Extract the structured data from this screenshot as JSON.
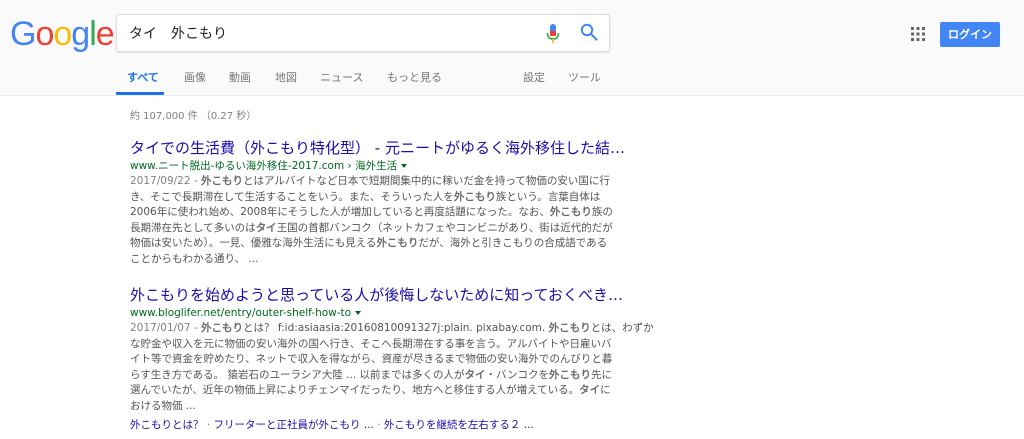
{
  "logo": {
    "letters": [
      {
        "ch": "G",
        "color": "#4285F4"
      },
      {
        "ch": "o",
        "color": "#EA4335"
      },
      {
        "ch": "o",
        "color": "#FBBC05"
      },
      {
        "ch": "g",
        "color": "#4285F4"
      },
      {
        "ch": "l",
        "color": "#34A853"
      },
      {
        "ch": "e",
        "color": "#EA4335"
      }
    ]
  },
  "search": {
    "query": "タイ　外こもり"
  },
  "header": {
    "login_label": "ログイン"
  },
  "icons": {
    "mic": "mic-icon",
    "search": "search-icon",
    "apps": "apps-grid-icon"
  },
  "tabs": [
    {
      "label": "すべて",
      "active": true
    },
    {
      "label": "画像"
    },
    {
      "label": "動画"
    },
    {
      "label": "地図"
    },
    {
      "label": "ニュース"
    },
    {
      "label": "もっと見る"
    },
    {
      "label": "設定"
    },
    {
      "label": "ツール"
    }
  ],
  "result_stats": "約 107,000 件 （0.27 秒）",
  "results": [
    {
      "title": "タイでの生活費（外こもり特化型） - 元ニートがゆるく海外移住した結…",
      "url": "www.ニート脱出-ゆるい海外移住-2017.com › 海外生活",
      "date": "2017/09/22 - ",
      "snippet_lines": [
        [
          {
            "b": "外こもり"
          },
          {
            "t": "とはアルバイトなど日本で短期間集中的に稼いだ金を持って物価の安い国に行"
          }
        ],
        [
          {
            "t": "き、そこで長期滞在して生活することをいう。また、そういった人を"
          },
          {
            "b": "外こもり"
          },
          {
            "t": "族という。言葉自体は"
          }
        ],
        [
          {
            "t": "2006年に使われ始め、2008年にそうした人が増加していると再度話題になった。なお、"
          },
          {
            "b": "外こもり"
          },
          {
            "t": "族の"
          }
        ],
        [
          {
            "t": "長期滞在先として多いのは"
          },
          {
            "b": "タイ"
          },
          {
            "t": "王国の首都バンコク（ネットカフェやコンビニがあり、街は近代的だが"
          }
        ],
        [
          {
            "t": "物価は安いため）。一見、優雅な海外生活にも見える"
          },
          {
            "b": "外こもり"
          },
          {
            "t": "だが、海外と引きこもりの合成語である"
          }
        ],
        [
          {
            "t": "ことからもわかる通り、 ..."
          }
        ]
      ]
    },
    {
      "title": "外こもりを始めようと思っている人が後悔しないために知っておくべき…",
      "url": "www.bloglifer.net/entry/outer-shelf-how-to",
      "date": "2017/01/07 - ",
      "snippet_lines": [
        [
          {
            "b": "外こもり"
          },
          {
            "t": "とは？ f:id:asiaasia:20160810091327j:plain. pixabay.com. "
          },
          {
            "b": "外こもり"
          },
          {
            "t": "とは、わずか"
          }
        ],
        [
          {
            "t": "な貯金や収入を元に物価の安い海外の国へ行き、そこへ長期滞在する事を言う。アルバイトや日雇いバ"
          }
        ],
        [
          {
            "t": "イト等で資金を貯めたり、ネットで収入を得ながら、資産が尽きるまで物価の安い海外でのんびりと暮"
          }
        ],
        [
          {
            "t": "らす生き方である。 猿岩石のユーラシア大陸 ... 以前までは多くの人が"
          },
          {
            "b": "タイ"
          },
          {
            "t": "・バンコクを"
          },
          {
            "b": "外こもり"
          },
          {
            "t": "先に"
          }
        ],
        [
          {
            "t": "選んでいたが、近年の物価上昇によりチェンマイだったり、地方へと移住する人が増えている。"
          },
          {
            "b": "タイ"
          },
          {
            "t": "に"
          }
        ],
        [
          {
            "t": "おける物価 ..."
          }
        ]
      ],
      "sitelinks": [
        "外こもりとは？",
        "フリーターと正社員が外こもり ...",
        "外こもりを継続を左右する２ ..."
      ],
      "sitelink_separator": " · "
    }
  ]
}
